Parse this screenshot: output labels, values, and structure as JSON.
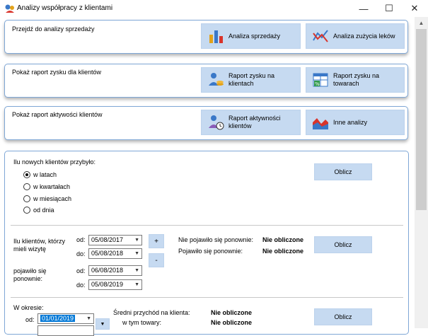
{
  "window": {
    "title": "Analizy współpracy z klientami",
    "minimize": "—",
    "maximize": "☐",
    "close": "✕"
  },
  "panel1": {
    "label": "Przejdź do analizy sprzedaży",
    "btn1": "Analiza sprzedaży",
    "btn2": "Analiza zużycia leków"
  },
  "panel2": {
    "label": "Pokaż raport zysku dla klientów",
    "btn1_l1": "Raport zysku na",
    "btn1_l2": "klientach",
    "btn2_l1": "Raport zysku na",
    "btn2_l2": "towarach"
  },
  "panel3": {
    "label": "Pokaż raport aktywości klientów",
    "btn1_l1": "Raport aktywności",
    "btn1_l2": "klientów",
    "btn2": "Inne analizy"
  },
  "new_clients": {
    "label": "Ilu nowych klientów przybyło:",
    "options": [
      "w latach",
      "w kwartałach",
      "w miesiącach",
      "od dnia"
    ],
    "selected": 0,
    "calc": "Oblicz"
  },
  "returning": {
    "label_l1": "Ilu klientów, którzy",
    "label_l2": "mieli wizytę",
    "label2_l1": "pojawiło się",
    "label2_l2": "ponownie:",
    "od": "od:",
    "do": "do:",
    "date1_from": "05/08/2017",
    "date1_to": "05/08/2018",
    "date2_from": "06/08/2018",
    "date2_to": "05/08/2019",
    "plus": "+",
    "minus": "-",
    "not_returned_label": "Nie pojawiło się ponownie:",
    "not_returned_value": "Nie obliczone",
    "returned_label": "Pojawiło się ponownie:",
    "returned_value": "Nie obliczone",
    "calc": "Oblicz"
  },
  "period": {
    "label": "W okresie:",
    "od": "od:",
    "date_from": "01/01/2019",
    "avg_label": "Średni przychód na klienta:",
    "avg_value": "Nie obliczone",
    "goods_label": "w tym towary:",
    "goods_value": "Nie obliczone",
    "calc": "Oblicz"
  }
}
